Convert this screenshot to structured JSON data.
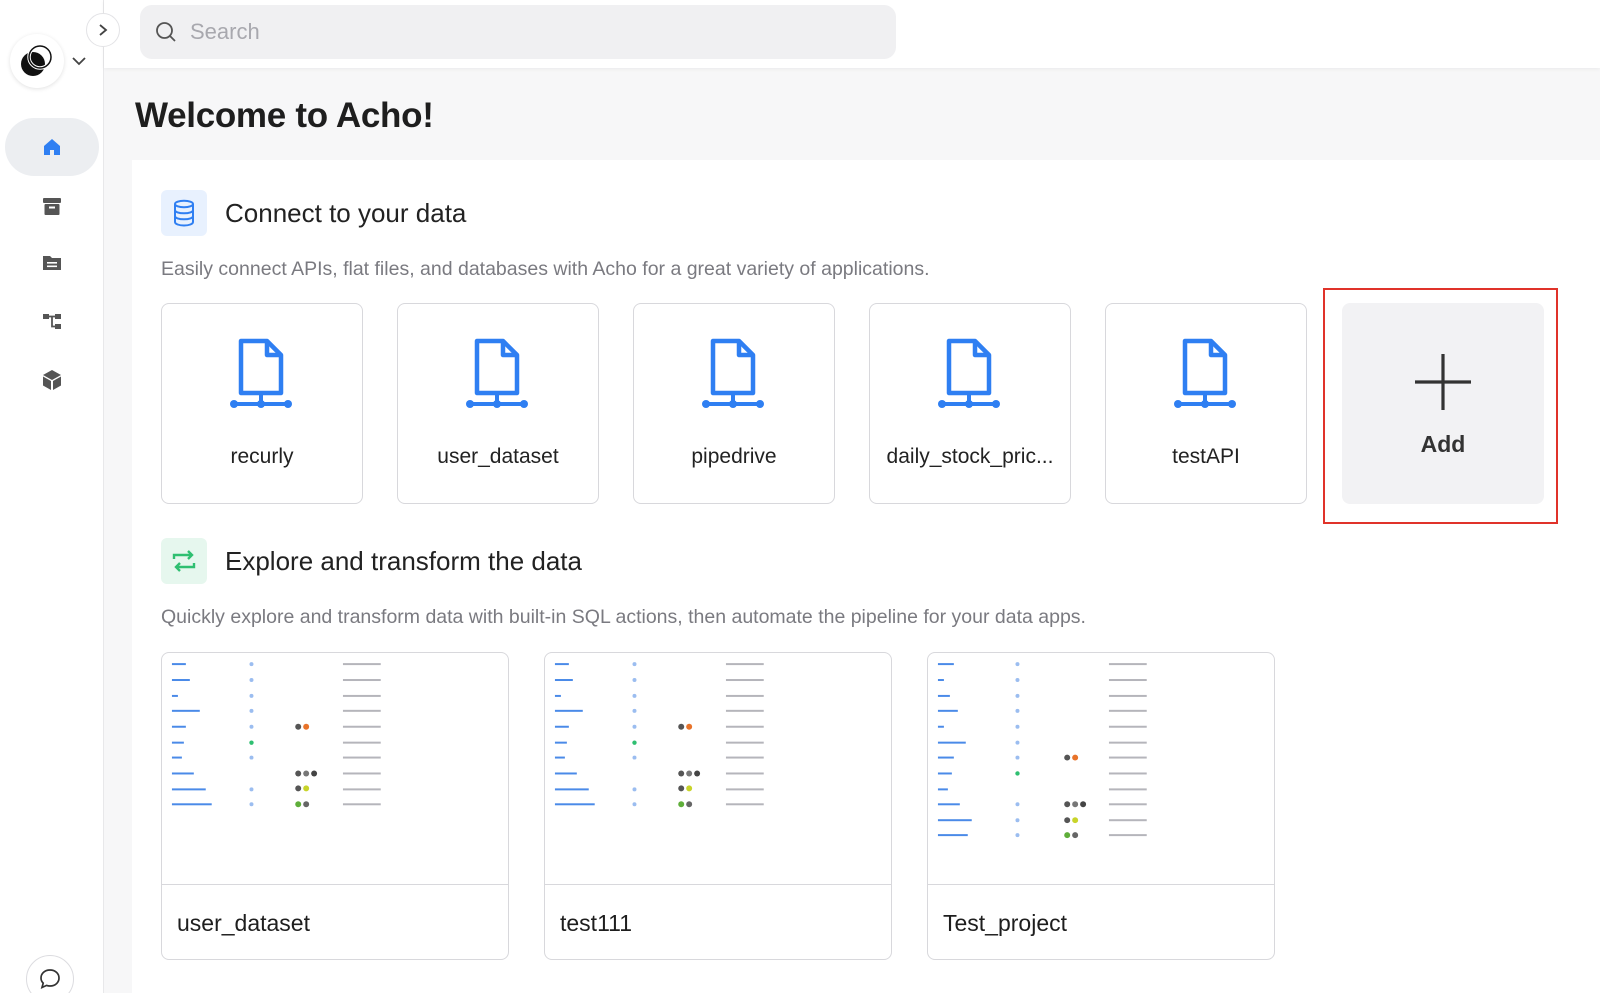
{
  "search": {
    "placeholder": "Search"
  },
  "page": {
    "title": "Welcome to Acho!"
  },
  "sidebar": {
    "items": [
      {
        "icon": "home-icon",
        "active": true
      },
      {
        "icon": "archive-icon",
        "active": false
      },
      {
        "icon": "folder-icon",
        "active": false
      },
      {
        "icon": "workflow-icon",
        "active": false
      },
      {
        "icon": "cube-icon",
        "active": false
      }
    ]
  },
  "connect": {
    "title": "Connect to your data",
    "description": "Easily connect APIs, flat files, and databases with Acho for a great variety of applications.",
    "sources": [
      "recurly",
      "user_dataset",
      "pipedrive",
      "daily_stock_pric...",
      "testAPI"
    ],
    "add_label": "Add"
  },
  "explore": {
    "title": "Explore and transform the data",
    "description": "Quickly explore and transform data with built-in SQL actions, then automate the pipeline for your data apps.",
    "projects": [
      "user_dataset",
      "test111",
      "Test_project"
    ]
  },
  "colors": {
    "accent": "#2f7ff2",
    "green": "#2fbf71",
    "highlight": "#e0332a"
  }
}
